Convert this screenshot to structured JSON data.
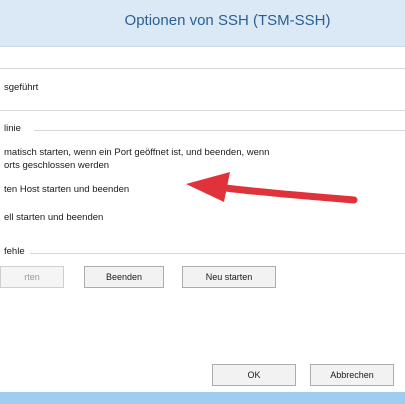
{
  "window": {
    "title": "Optionen von SSH (TSM-SSH)"
  },
  "status": {
    "text": "sgeführt"
  },
  "policy_group": {
    "label": "linie",
    "option1_line1": "matisch starten, wenn ein Port geöffnet ist, und beenden, wenn",
    "option1_line2": "orts geschlossen werden",
    "option2": "ten Host starten und beenden",
    "option3": "ell starten und beenden"
  },
  "actions_group": {
    "label": "fehle",
    "start_label": "rten",
    "stop_label": "Beenden",
    "restart_label": "Neu starten"
  },
  "footer": {
    "ok_label": "OK",
    "cancel_label": "Abbrechen"
  },
  "colors": {
    "arrow": "#e0323a",
    "title": "#2b5f93",
    "titlebar": "#dbe9f6",
    "bottom_strip": "#9fcdf2"
  }
}
